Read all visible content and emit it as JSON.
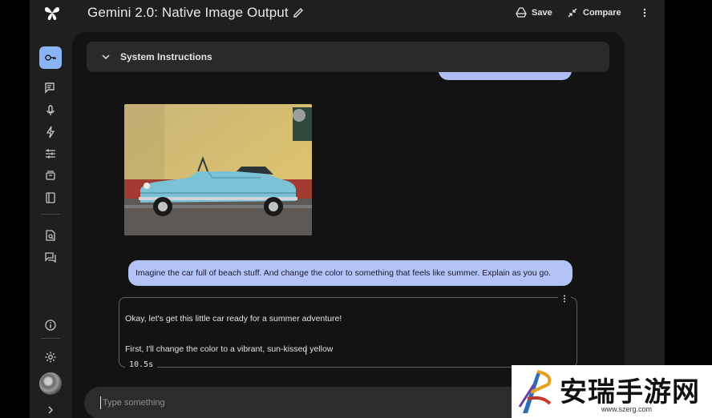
{
  "header": {
    "title": "Gemini 2.0: Native Image Output",
    "save_label": "Save",
    "compare_label": "Compare"
  },
  "sidebar": {
    "items": [
      {
        "icon": "key-icon",
        "active": true
      },
      {
        "icon": "chat-prompt-icon"
      },
      {
        "icon": "mic-icon"
      },
      {
        "icon": "bolt-icon"
      },
      {
        "icon": "tune-icon"
      },
      {
        "icon": "archive-icon"
      },
      {
        "icon": "library-icon"
      },
      {
        "icon": "doc-search-icon"
      },
      {
        "icon": "forum-icon"
      },
      {
        "icon": "info-icon"
      },
      {
        "icon": "settings-icon"
      },
      {
        "icon": "avatar"
      },
      {
        "icon": "chevron-right-icon"
      }
    ]
  },
  "system_instructions": {
    "label": "System Instructions"
  },
  "conversation": {
    "user_message": "Imagine the car full of beach stuff. And change the color to something that feels like summer. Explain as you go.",
    "response_line1": "Okay, let's get this little car ready for a summer adventure!",
    "response_line2": "First, I'll change the color to a vibrant, sun-kissed yellow",
    "elapsed": "10.5s"
  },
  "composer": {
    "placeholder": "Type something"
  },
  "watermark": {
    "text": "安瑞手游网",
    "url": "www.szerg.com"
  },
  "colors": {
    "accent": "#8ab4f8",
    "user_bubble": "#b4c3f6",
    "background": "#1f1f1f",
    "panel": "#131314"
  }
}
